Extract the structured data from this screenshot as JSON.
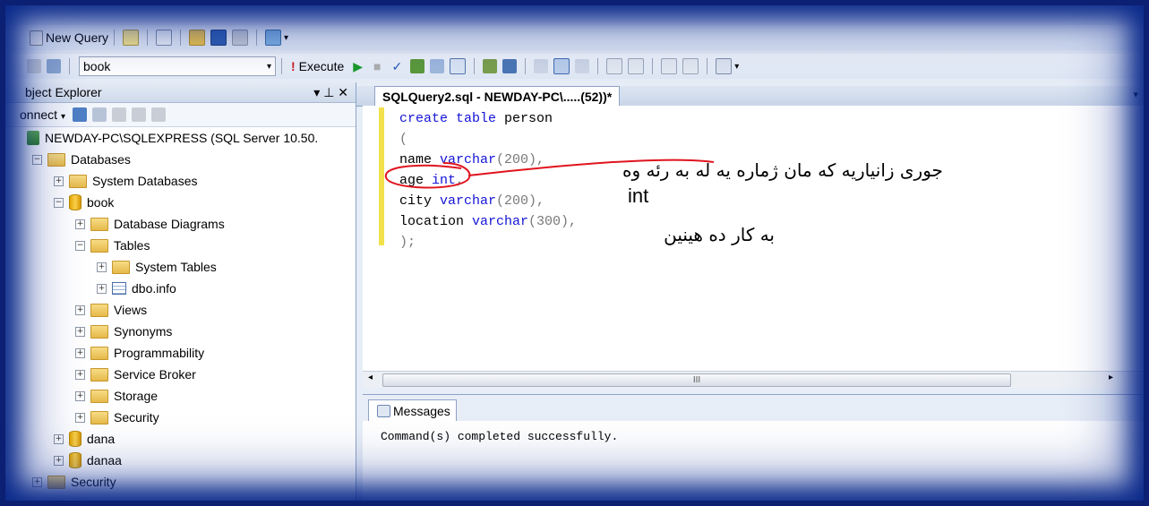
{
  "toolbar1": {
    "new_query": "New Query"
  },
  "toolbar2": {
    "database": "book",
    "execute": "Execute"
  },
  "object_explorer": {
    "title": "bject Explorer",
    "connect": "onnect",
    "pin": "▾ ⊥ ✕",
    "nodes": [
      {
        "label": "NEWDAY-PC\\SQLEXPRESS (SQL Server 10.50.",
        "level": 0,
        "expander": "",
        "icon": "server-icon"
      },
      {
        "label": "Databases",
        "level": 1,
        "expander": "−",
        "icon": "folder-icon"
      },
      {
        "label": "System Databases",
        "level": 2,
        "expander": "+",
        "icon": "folder-icon"
      },
      {
        "label": "book",
        "level": 2,
        "expander": "−",
        "icon": "database-icon"
      },
      {
        "label": "Database Diagrams",
        "level": 3,
        "expander": "+",
        "icon": "folder-icon"
      },
      {
        "label": "Tables",
        "level": 3,
        "expander": "−",
        "icon": "folder-icon"
      },
      {
        "label": "System Tables",
        "level": 4,
        "expander": "+",
        "icon": "folder-icon"
      },
      {
        "label": "dbo.info",
        "level": 4,
        "expander": "+",
        "icon": "table-icon"
      },
      {
        "label": "Views",
        "level": 3,
        "expander": "+",
        "icon": "folder-icon"
      },
      {
        "label": "Synonyms",
        "level": 3,
        "expander": "+",
        "icon": "folder-icon"
      },
      {
        "label": "Programmability",
        "level": 3,
        "expander": "+",
        "icon": "folder-icon"
      },
      {
        "label": "Service Broker",
        "level": 3,
        "expander": "+",
        "icon": "folder-icon"
      },
      {
        "label": "Storage",
        "level": 3,
        "expander": "+",
        "icon": "folder-icon"
      },
      {
        "label": "Security",
        "level": 3,
        "expander": "+",
        "icon": "folder-icon"
      },
      {
        "label": "dana",
        "level": 2,
        "expander": "+",
        "icon": "database-icon"
      },
      {
        "label": "danaa",
        "level": 2,
        "expander": "+",
        "icon": "database-icon"
      },
      {
        "label": "Security",
        "level": 1,
        "expander": "+",
        "icon": "folder-icon"
      }
    ]
  },
  "editor": {
    "tab_label": "SQLQuery2.sql - NEWDAY-PC\\.....(52))*",
    "code": {
      "l1a": "create table",
      "l1b": " person",
      "l2": "(",
      "l3a": "name ",
      "l3b": "varchar",
      "l3c": "(200),",
      "l4a": "age ",
      "l4b": "int",
      "l4c": ",",
      "l5a": "city ",
      "l5b": "varchar",
      "l5c": "(200),",
      "l6a": "location ",
      "l6b": "varchar",
      "l6c": "(300),",
      "l7": ");"
    },
    "note_line1": "جوری زانیاریه که مان ژماره یه له به رئه وه",
    "note_line2": "int",
    "note_line3": "به کار ده هینین",
    "scroll_grip": "III"
  },
  "messages": {
    "tab": "Messages",
    "text": "Command(s) completed successfully."
  },
  "colors": {
    "keyword": "#1515d6",
    "annotation": "#e0141e",
    "frame": "#0b1f73"
  }
}
